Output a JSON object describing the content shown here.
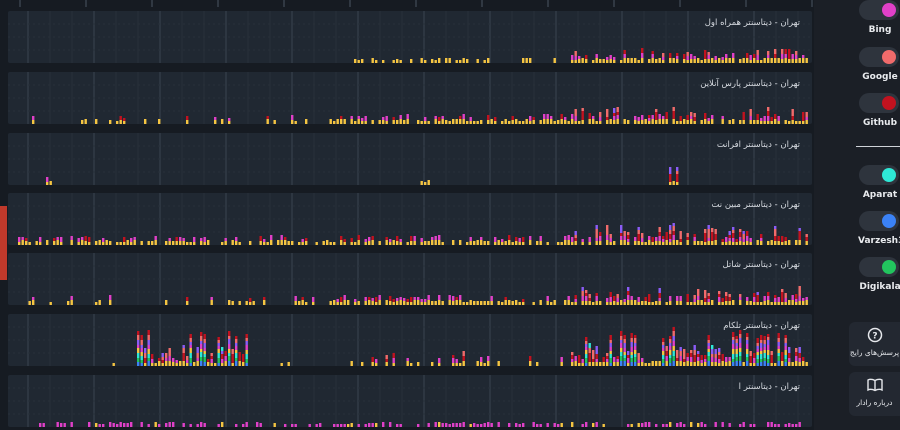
{
  "panels": [
    {
      "label": "تهران - دیتاسنتر همراه اول",
      "pattern": "low-late"
    },
    {
      "label": "تهران - دیتاسنتر پارس آنلاین",
      "pattern": "medium"
    },
    {
      "label": "تهران - دیتاسنتر افرانت",
      "pattern": "sparse"
    },
    {
      "label": "تهران - دیتاسنتر مبین نت",
      "pattern": "medium-dense"
    },
    {
      "label": "تهران - دیتاسنتر شاتل",
      "pattern": "medium"
    },
    {
      "label": "تهران - دیتاسنتر تلکام",
      "pattern": "full-outage"
    },
    {
      "label": "تهران - دیتاسنتر ا",
      "pattern": "low"
    }
  ],
  "services": [
    {
      "name": "Bing",
      "color": "#e040c8"
    },
    {
      "name": "Google",
      "color": "#f06b6b"
    },
    {
      "name": "Github",
      "color": "#c1121f"
    },
    {
      "name": "Aparat",
      "color": "#2ee8d6"
    },
    {
      "name": "Varzesh3",
      "color": "#3b82f6"
    },
    {
      "name": "Digikala",
      "color": "#22c55e"
    }
  ],
  "bar_colors": [
    "#f5c542",
    "#e040c8",
    "#c1121f",
    "#f06b6b",
    "#8b5cf6",
    "#2ee8d6",
    "#3b82f6",
    "#22c55e"
  ],
  "buttons": {
    "faq": {
      "label": "پرسش‌های رایج",
      "icon": "?"
    },
    "about": {
      "label": "درباره رادار",
      "icon": "📖"
    }
  }
}
